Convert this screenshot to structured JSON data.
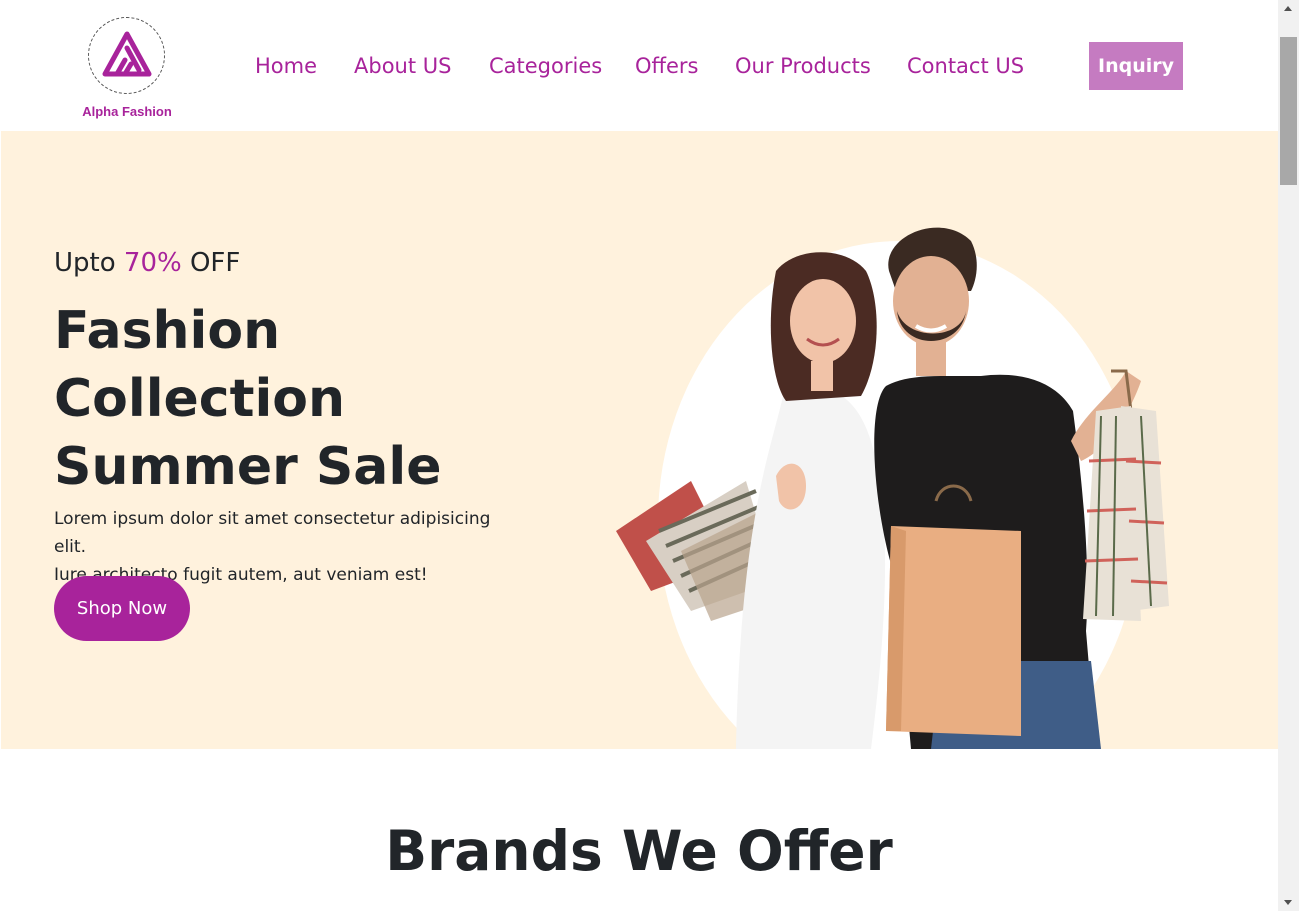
{
  "header": {
    "logo_text": "Alpha Fashion",
    "nav": [
      "Home",
      "About US",
      "Categories",
      "Offers",
      "Our Products",
      "Contact US"
    ],
    "inquiry_label": "Inquiry"
  },
  "hero": {
    "promo_prefix": "Upto ",
    "promo_percent": "70%",
    "promo_suffix": " OFF",
    "headline_line1": "Fashion",
    "headline_line2": "Collection",
    "headline_line3": "Summer Sale",
    "description_line1": "Lorem ipsum dolor sit amet consectetur adipisicing elit.",
    "description_line2": "Iure architecto fugit autem, aut veniam est!",
    "shop_label": "Shop Now"
  },
  "brands": {
    "title": "Brands We Offer"
  },
  "colors": {
    "accent": "#a8239b",
    "inquiry_bg": "#c57bc1",
    "hero_bg": "#fff2dd",
    "text": "#212529"
  },
  "icons": {
    "logo": "alpha-triangle-logo",
    "scroll_up": "arrow-up-icon",
    "scroll_down": "arrow-down-icon"
  }
}
